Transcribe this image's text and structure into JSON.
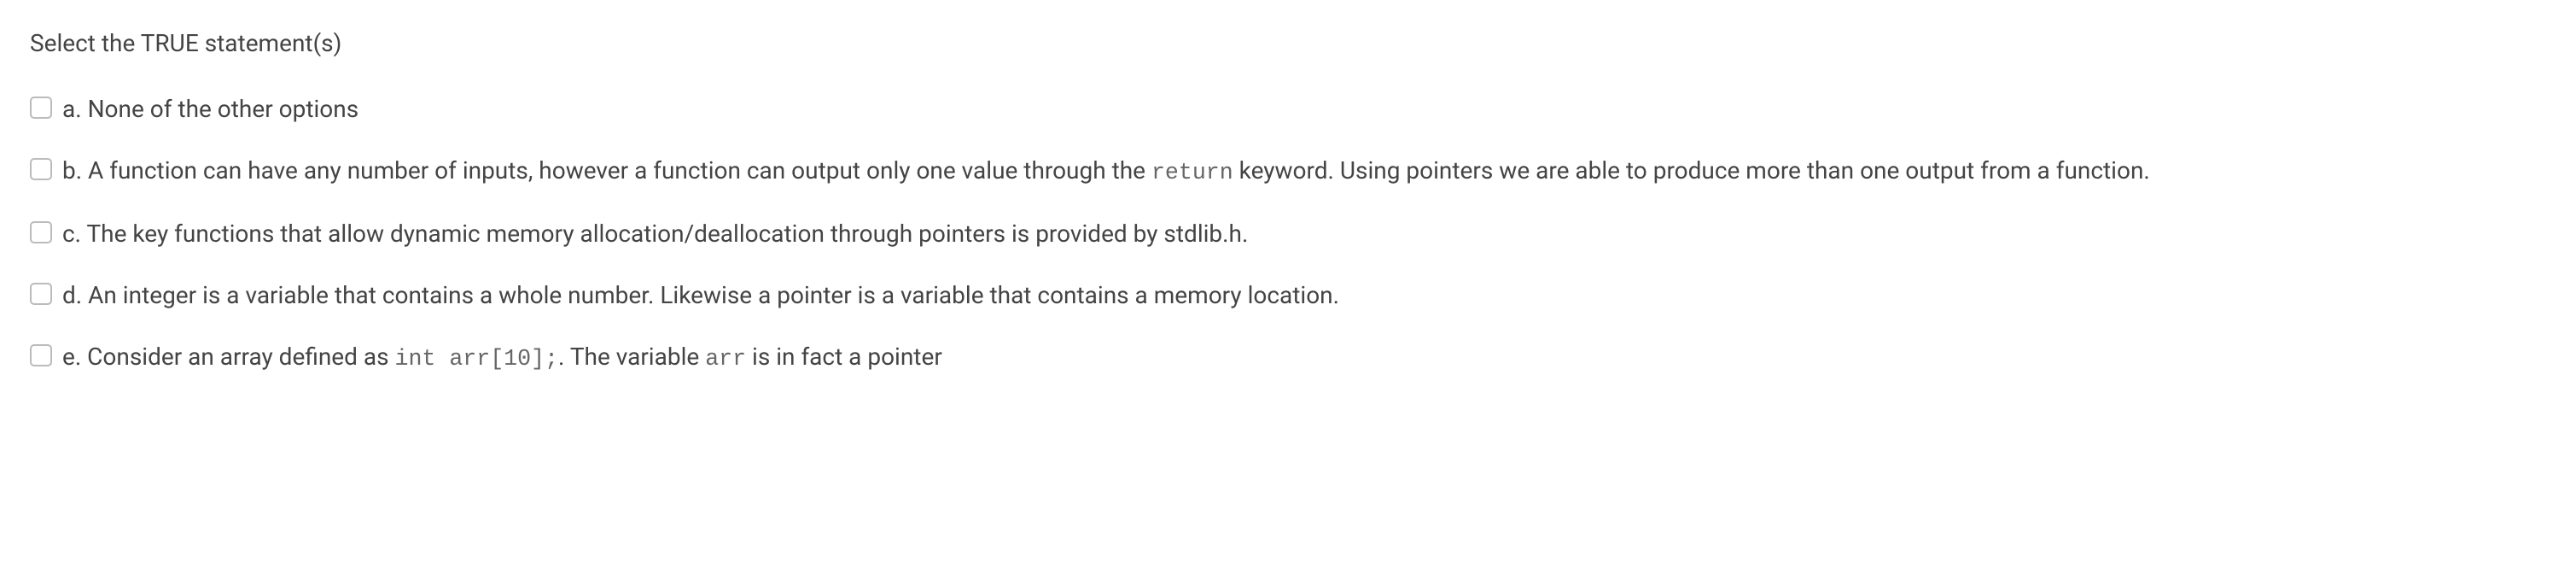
{
  "question": {
    "prompt": "Select the TRUE statement(s)",
    "options": [
      {
        "letter": "a.",
        "text_parts": [
          {
            "type": "text",
            "value": " None of the other options"
          }
        ]
      },
      {
        "letter": "b.",
        "text_parts": [
          {
            "type": "text",
            "value": " A function can have any number of inputs, however a function can output only one value through the "
          },
          {
            "type": "code",
            "value": "return"
          },
          {
            "type": "text",
            "value": " keyword. Using pointers we are able to produce more than one output from a function."
          }
        ]
      },
      {
        "letter": "c.",
        "text_parts": [
          {
            "type": "text",
            "value": " The key functions that allow dynamic memory allocation/deallocation through pointers is provided by stdlib.h."
          }
        ]
      },
      {
        "letter": "d.",
        "text_parts": [
          {
            "type": "text",
            "value": " An integer is a variable that contains a whole number. Likewise a pointer is a variable that contains a memory location."
          }
        ]
      },
      {
        "letter": "e.",
        "text_parts": [
          {
            "type": "text",
            "value": " Consider an array defined as "
          },
          {
            "type": "code",
            "value": "int arr[10];"
          },
          {
            "type": "text",
            "value": ". The variable "
          },
          {
            "type": "code",
            "value": "arr"
          },
          {
            "type": "text",
            "value": " is in fact a pointer"
          }
        ]
      }
    ]
  }
}
